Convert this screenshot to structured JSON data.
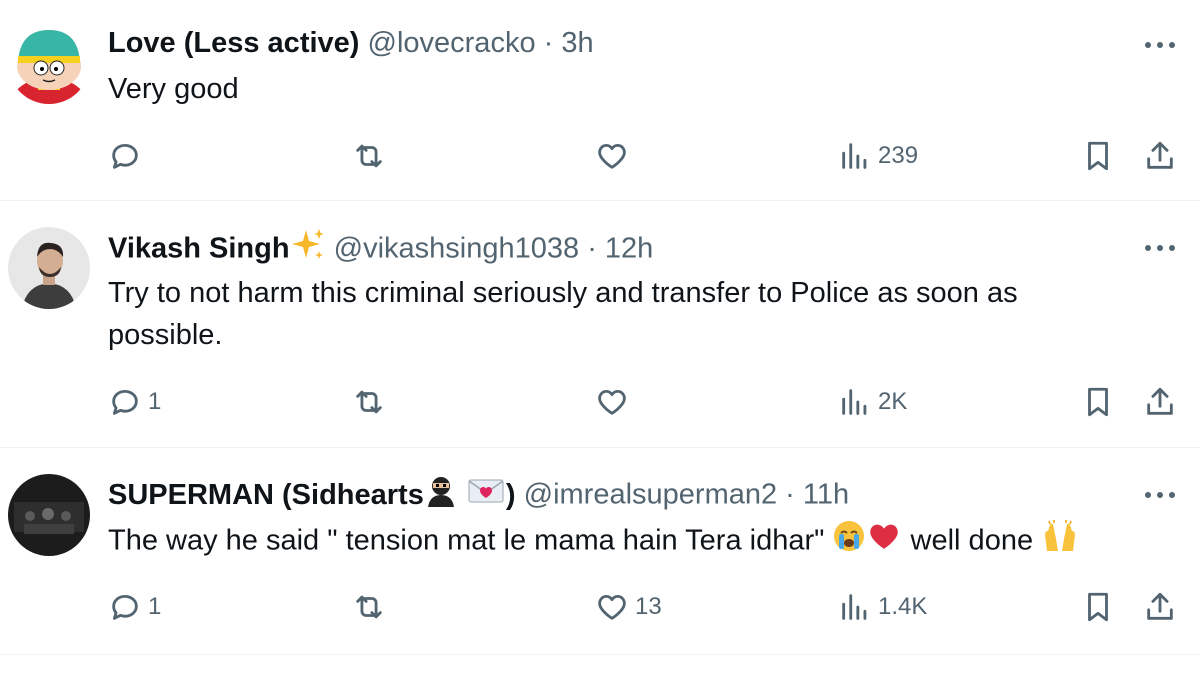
{
  "tweets": [
    {
      "name": "Love (Less active)",
      "handle": "@lovecracko",
      "dot": "·",
      "time": "3h",
      "text_lines": [
        "Very good"
      ],
      "replies": "",
      "retweets": "",
      "likes": "",
      "views": "239",
      "avatar": "cartoon-avatar-icon"
    },
    {
      "name": "Vikash Singh",
      "handle": "@vikashsingh1038",
      "dot": "·",
      "time": "12h",
      "text_lines": [
        "Try to not harm this criminal seriously and transfer to Police as soon as",
        "possible."
      ],
      "replies": "1",
      "retweets": "",
      "likes": "",
      "views": "2K",
      "avatar": "person-avatar-icon"
    },
    {
      "name": "SUPERMAN (Sidhearts",
      "name_close": ")",
      "handle": "@imrealsuperman2",
      "dot": "·",
      "time": "11h",
      "text_main": "The way he said \" tension mat le mama hain Tera idhar\"",
      "text_end": "well done",
      "replies": "1",
      "retweets": "",
      "likes": "13",
      "views": "1.4K",
      "avatar": "dark-photo-avatar-icon"
    }
  ],
  "colors": {
    "text": "#0f1419",
    "secondary": "#536471",
    "divider": "#eff3f4"
  }
}
